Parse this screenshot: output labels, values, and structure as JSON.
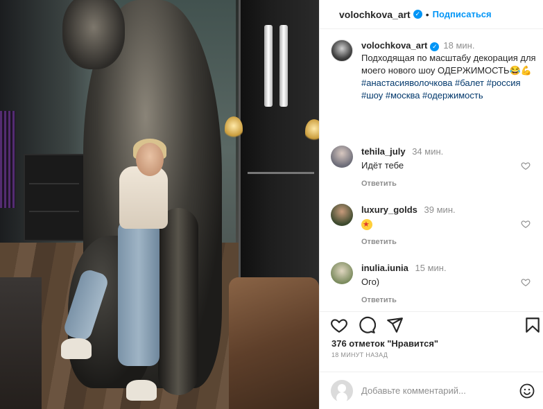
{
  "post": {
    "username": "volochkova_art",
    "follow_label": "Подписаться",
    "separator": "•"
  },
  "caption": {
    "username": "volochkova_art",
    "time": "18 мин.",
    "text": "Подходящая по масштабу декорация для моего нового шоу ОДЕРЖИМОСТЬ😂💪",
    "hashtags": "#анастасияволочкова #балет #россия #шоу #москва #одержимость"
  },
  "comments": [
    {
      "username": "tehila_july",
      "time": "34 мин.",
      "text": "Идёт тебе",
      "reply_label": "Ответить"
    },
    {
      "username": "luxury_golds",
      "time": "39 мин.",
      "text": "",
      "emoji": "star-struck",
      "reply_label": "Ответить"
    },
    {
      "username": "inulia.iunia",
      "time": "15 мин.",
      "text": "Ого)",
      "reply_label": "Ответить"
    }
  ],
  "stats": {
    "likes": "376 отметок \"Нравится\"",
    "posted_ago": "18 МИНУТ НАЗАД"
  },
  "add_comment": {
    "placeholder": "Добавьте комментарий..."
  },
  "colors": {
    "accent": "#0095f6",
    "hashtag": "#00376b",
    "muted": "#8e8e8e",
    "text": "#262626"
  },
  "icons": [
    "verified-badge-icon",
    "heart-icon",
    "comment-icon",
    "share-icon",
    "bookmark-icon",
    "emoji-icon"
  ]
}
